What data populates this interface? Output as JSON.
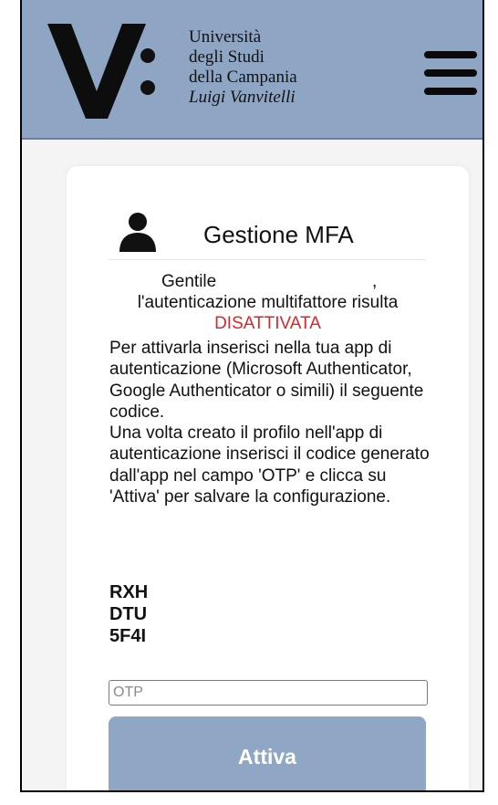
{
  "header": {
    "logo_lines": [
      "Università",
      "degli Studi",
      "della Campania"
    ],
    "logo_italic": "Luigi Vanvitelli",
    "logo_letter": "V:",
    "brand_color": "#8ea6c4"
  },
  "menu": {
    "icon": "hamburger-menu-icon"
  },
  "card": {
    "title": "Gestione MFA",
    "title_icon": "user-icon",
    "greeting": "Gentile",
    "greeting_comma": ",",
    "status_text": "l'autenticazione multifattore risulta",
    "status_value": "DISATTIVATA",
    "status_color": "#d9262c",
    "instructions": [
      "Per attivarla inserisci nella tua app di autenticazione (Microsoft Authenticator, Google Authenticator o simili) il seguente codice.",
      "Una volta creato il profilo nell'app di autenticazione inserisci il codice generato dall'app nel campo 'OTP' e clicca su 'Attiva' per salvare la configurazione."
    ],
    "code_lines": [
      "RXH",
      "DTU",
      "5F4I"
    ]
  },
  "form": {
    "otp_placeholder": "OTP",
    "otp_value": "",
    "submit_label": "Attiva",
    "button_color": "#8fa7c4"
  }
}
